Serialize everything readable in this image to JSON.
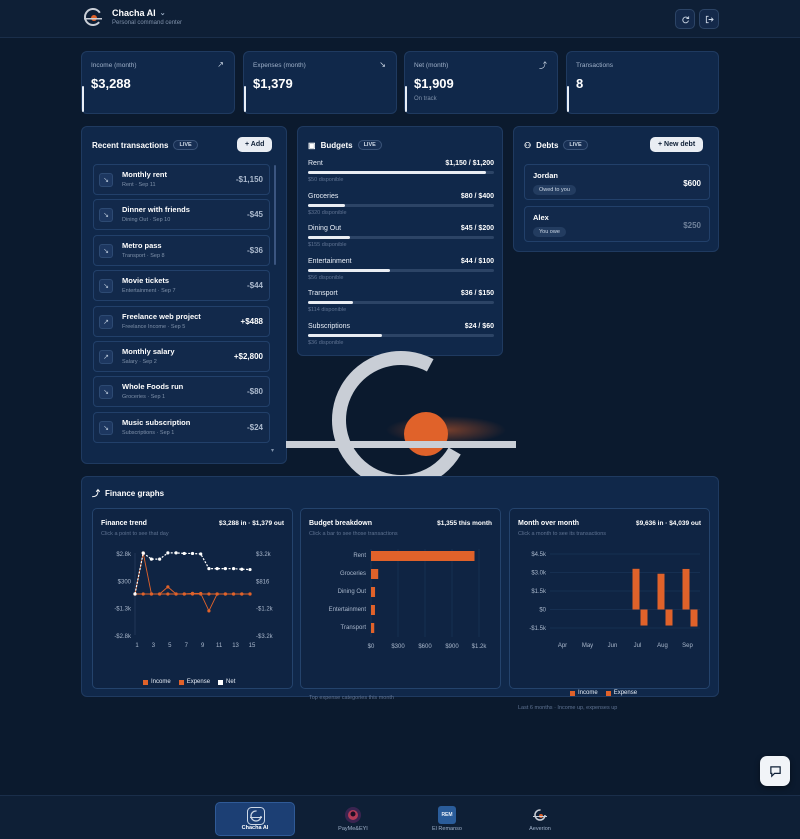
{
  "app": {
    "title": "Chacha AI",
    "subtitle": "Personal command center"
  },
  "colors": {
    "bg": "#0b1a2e",
    "card": "#10284a",
    "accent": "#e0622a",
    "text": "#e8eef7"
  },
  "stats": [
    {
      "label": "Income (month)",
      "value": "$3,288",
      "icon": "arrow-up-right-icon"
    },
    {
      "label": "Expenses (month)",
      "value": "$1,379",
      "icon": "arrow-down-right-icon"
    },
    {
      "label": "Net (month)",
      "value": "$1,909",
      "sub": "On track",
      "icon": "trend-up-icon"
    },
    {
      "label": "Transactions",
      "value": "8"
    }
  ],
  "transactions": {
    "title": "Recent transactions",
    "live": "LIVE",
    "add_label": "+ Add",
    "items": [
      {
        "name": "Monthly rent",
        "sub": "Rent · Sep 11",
        "amount": "-$1,150",
        "dir": "down"
      },
      {
        "name": "Dinner with friends",
        "sub": "Dining Out · Sep 10",
        "amount": "-$45",
        "dir": "down"
      },
      {
        "name": "Metro pass",
        "sub": "Transport · Sep 8",
        "amount": "-$36",
        "dir": "down"
      },
      {
        "name": "Movie tickets",
        "sub": "Entertainment · Sep 7",
        "amount": "-$44",
        "dir": "down"
      },
      {
        "name": "Freelance web project",
        "sub": "Freelance Income · Sep 5",
        "amount": "+$488",
        "dir": "up"
      },
      {
        "name": "Monthly salary",
        "sub": "Salary · Sep 2",
        "amount": "+$2,800",
        "dir": "up"
      },
      {
        "name": "Whole Foods run",
        "sub": "Groceries · Sep 1",
        "amount": "-$80",
        "dir": "down"
      },
      {
        "name": "Music subscription",
        "sub": "Subscriptions · Sep 1",
        "amount": "-$24",
        "dir": "down"
      }
    ]
  },
  "budgets": {
    "title": "Budgets",
    "live": "LIVE",
    "items": [
      {
        "name": "Rent",
        "amount": "$1,150 / $1,200",
        "remaining": "$50 disponible",
        "fraction": 0.958
      },
      {
        "name": "Groceries",
        "amount": "$80 / $400",
        "remaining": "$320 disponible",
        "fraction": 0.2
      },
      {
        "name": "Dining Out",
        "amount": "$45 / $200",
        "remaining": "$155 disponible",
        "fraction": 0.225
      },
      {
        "name": "Entertainment",
        "amount": "$44 / $100",
        "remaining": "$56 disponible",
        "fraction": 0.44
      },
      {
        "name": "Transport",
        "amount": "$36 / $150",
        "remaining": "$114 disponible",
        "fraction": 0.24
      },
      {
        "name": "Subscriptions",
        "amount": "$24 / $60",
        "remaining": "$36 disponible",
        "fraction": 0.4
      }
    ]
  },
  "debts": {
    "title": "Debts",
    "live": "LIVE",
    "new_label": "+ New debt",
    "items": [
      {
        "name": "Jordan",
        "tag": "Owed to you",
        "amount": "$600"
      },
      {
        "name": "Alex",
        "tag": "You owe",
        "amount": "$250"
      }
    ]
  },
  "graphs": {
    "title": "Finance graphs",
    "trend": {
      "title": "Finance trend",
      "summary": "$3,288 in · $1,379 out",
      "hint": "Click a point to see that day",
      "legend": [
        "Income",
        "Expense",
        "Net"
      ]
    },
    "budget": {
      "title": "Budget breakdown",
      "summary": "$1,355 this month",
      "hint": "Click a bar to see those transactions",
      "footer": "Top expense categories this month"
    },
    "mom": {
      "title": "Month over month",
      "summary": "$9,636 in · $4,039 out",
      "hint": "Click a month to see its transactions",
      "footer": "Last 6 months · Income up, expenses up",
      "legend": [
        "Income",
        "Expense"
      ]
    }
  },
  "chart_data": [
    {
      "type": "line",
      "title": "Finance trend",
      "x": [
        1,
        2,
        3,
        4,
        5,
        6,
        7,
        8,
        9,
        10,
        11,
        12,
        13,
        14,
        15
      ],
      "xticks": [
        "1",
        "3",
        "5",
        "7",
        "9",
        "11",
        "13",
        "15"
      ],
      "yticks_left": [
        "$2.8k",
        "$300",
        "-$1.3k",
        "-$2.8k"
      ],
      "yticks_right": [
        "$3.2k",
        "$816",
        "-$1.2k",
        "-$3.2k"
      ],
      "ylim_left": [
        -2800,
        2800
      ],
      "ylim_right": [
        -3200,
        3200
      ],
      "series": [
        {
          "name": "Income",
          "axis": "left",
          "values": [
            0,
            2800,
            0,
            0,
            488,
            0,
            0,
            0,
            0,
            0,
            0,
            0,
            0,
            0,
            0
          ]
        },
        {
          "name": "Expense",
          "axis": "left",
          "values": [
            0,
            0,
            0,
            0,
            0,
            0,
            0,
            44,
            36,
            -1150,
            0,
            0,
            0,
            0,
            0
          ]
        },
        {
          "name": "Net",
          "axis": "right",
          "values": [
            0,
            3200,
            2720,
            2720,
            3208,
            3208,
            3164,
            3164,
            3128,
            1978,
            1978,
            1978,
            1978,
            1933,
            1909
          ]
        }
      ]
    },
    {
      "type": "bar",
      "title": "Budget breakdown",
      "orientation": "horizontal",
      "categories": [
        "Rent",
        "Groceries",
        "Dining Out",
        "Entertainment",
        "Transport"
      ],
      "values": [
        1150,
        80,
        45,
        44,
        36
      ],
      "xticks": [
        "$0",
        "$300",
        "$600",
        "$900",
        "$1.2k"
      ],
      "xlim": [
        0,
        1200
      ]
    },
    {
      "type": "bar",
      "title": "Month over month",
      "categories": [
        "Apr",
        "May",
        "Jun",
        "Jul",
        "Aug",
        "Sep"
      ],
      "yticks": [
        "$4.5k",
        "$3.0k",
        "$1.5k",
        "$0",
        "-$1.5k"
      ],
      "ylim": [
        -1500,
        4500
      ],
      "series": [
        {
          "name": "Income",
          "values": [
            0,
            0,
            0,
            3300,
            2900,
            3288
          ]
        },
        {
          "name": "Expense",
          "values": [
            0,
            0,
            0,
            -1300,
            -1300,
            -1379
          ]
        }
      ]
    }
  ],
  "nav": [
    {
      "label": "Chacha AI",
      "active": true
    },
    {
      "label": "PayMe&EYI"
    },
    {
      "label": "El Remanso",
      "icon_text": "REM"
    },
    {
      "label": "Aeverion"
    }
  ]
}
